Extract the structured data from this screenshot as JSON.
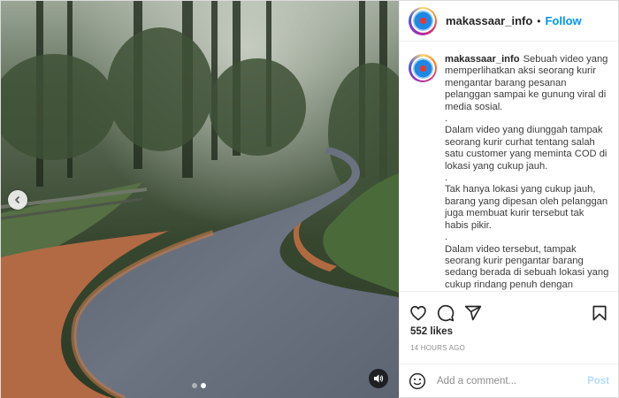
{
  "post": {
    "username": "makassaar_info",
    "separator": "•",
    "follow_label": "Follow",
    "caption": "Sebuah video yang memperlihatkan aksi seorang kurir mengantar barang pesanan pelanggan sampai ke gunung viral di media sosial.\n.\nDalam video yang diunggah tampak seorang kurir curhat tentang salah satu customer yang meminta COD di lokasi yang cukup jauh.\n.\nTak hanya lokasi yang cukup jauh, barang yang dipesan oleh pelanggan juga membuat kurir tersebut tak habis pikir.\n.\nDalam video tersebut, tampak seorang kurir pengantar barang sedang berada di sebuah lokasi yang cukup rindang penuh dengan pepohonan.",
    "likes": "552 likes",
    "timestamp": "14 HOURS AGO"
  },
  "media": {
    "carousel_total": 2,
    "carousel_active": 2
  },
  "comment": {
    "placeholder": "Add a comment...",
    "post_label": "Post"
  },
  "icons": {
    "like": "heart-icon",
    "comment": "comment-icon",
    "share": "share-icon",
    "save": "bookmark-icon",
    "emoji": "emoji-icon",
    "audio": "speaker-icon",
    "prev": "chevron-left-icon"
  },
  "colors": {
    "follow": "#0095f6",
    "post_disabled": "#b3dbff",
    "muted_text": "#8e8e8e",
    "border": "#efefef"
  }
}
